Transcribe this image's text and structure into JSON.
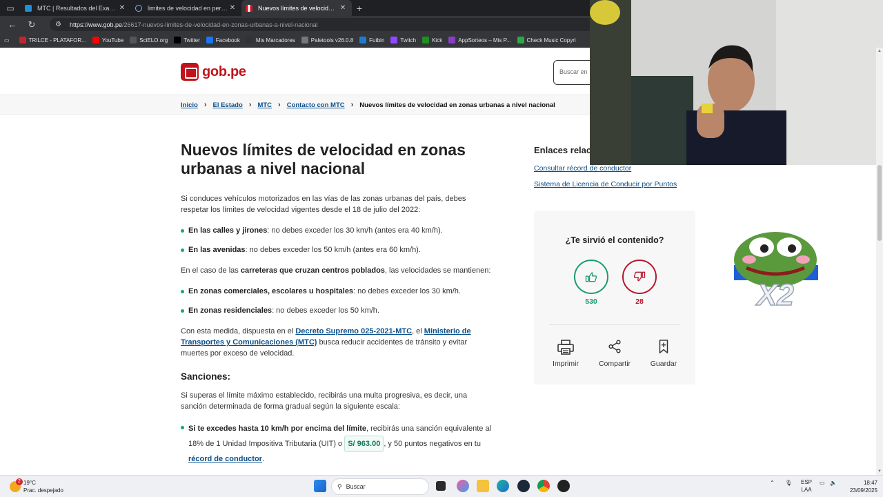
{
  "browser": {
    "tabs": [
      {
        "title": "MTC | Resultados del Examen de",
        "active": false
      },
      {
        "title": "limites de velocidad en peru - Bú",
        "active": false
      },
      {
        "title": "Nuevos límites de velocidad en zo",
        "active": true
      }
    ],
    "url_host": "https://www.gob.pe",
    "url_path": "/26617-nuevos-limites-de-velocidad-en-zonas-urbanas-a-nivel-nacional",
    "bookmarks": [
      {
        "label": "TRILCE - PLATAFOR...",
        "icon": "trilce-icon",
        "color": "#c0262d"
      },
      {
        "label": "YouTube",
        "icon": "youtube-icon",
        "color": "#ff0000"
      },
      {
        "label": "SciELO.org",
        "icon": "scielo-icon",
        "color": "#555555"
      },
      {
        "label": "Twitter",
        "icon": "x-icon",
        "color": "#000000"
      },
      {
        "label": "Facebook",
        "icon": "facebook-icon",
        "color": "#1877f2"
      },
      {
        "label": "Mis Marcadores",
        "icon": "bookmark-c-icon",
        "color": "#333333"
      },
      {
        "label": "Paletools v26.0.8",
        "icon": "globe-icon",
        "color": "#777777"
      },
      {
        "label": "Futbin",
        "icon": "futbin-icon",
        "color": "#1d7bd0"
      },
      {
        "label": "Twitch",
        "icon": "twitch-icon",
        "color": "#9146ff"
      },
      {
        "label": "Kick",
        "icon": "kick-icon",
        "color": "#1f8f1f"
      },
      {
        "label": "AppSorteos – Mis P...",
        "icon": "appsorteos-icon",
        "color": "#8a3cc9"
      },
      {
        "label": "Check Music Copyri",
        "icon": "check-icon",
        "color": "#2aa84a"
      }
    ]
  },
  "site": {
    "logo_text": "gob.pe",
    "search_placeholder": "Buscar en",
    "breadcrumbs": [
      "Inicio",
      "El Estado",
      "MTC",
      "Contacto con MTC"
    ],
    "breadcrumb_current": "Nuevos límites de velocidad en zonas urbanas a nivel nacional"
  },
  "article": {
    "title": "Nuevos límites de velocidad en zonas urbanas a nivel nacional",
    "intro": "Si conduces vehículos motorizados en las vías de las zonas urbanas del país, debes respetar los límites de velocidad vigentes desde el 18 de julio del 2022:",
    "urban_limits": [
      {
        "bold": "En las calles y jirones",
        "rest": ": no debes exceder los 30 km/h (antes era 40 km/h)."
      },
      {
        "bold": "En las avenidas",
        "rest": ": no debes exceder los 50 km/h (antes era 60 km/h)."
      }
    ],
    "roads_pre": "En el caso de las ",
    "roads_bold": "carreteras que cruzan centros poblados",
    "roads_post": ", las velocidades se mantienen:",
    "road_limits": [
      {
        "bold": "En zonas comerciales, escolares u hospitales",
        "rest": ": no debes exceder los 30 km/h."
      },
      {
        "bold": "En zonas residenciales",
        "rest": ": no debes exceder los 50 km/h."
      }
    ],
    "measure_pre": "Con esta medida, dispuesta en el ",
    "measure_link1": "Decreto Supremo 025-2021-MTC",
    "measure_mid": ", el ",
    "measure_link2": "Ministerio de Transportes y Comunicaciones (MTC)",
    "measure_post": " busca reducir accidentes de tránsito y evitar muertes por exceso de velocidad.",
    "sanctions_title": "Sanciones:",
    "sanctions_intro": "Si superas el límite máximo establecido, recibirás una multa progresiva, es decir, una sanción determinada de forma gradual según la siguiente escala:",
    "sanction1_bold": "Si te excedes hasta 10 km/h por encima del límite",
    "sanction1_mid": ", recibirás una sanción equivalente al 18% de 1 Unidad Impositiva Tributaria (UIT) o ",
    "sanction1_price": "S/ 963.00",
    "sanction1_post": ", y 50 puntos negativos en tu ",
    "sanction1_link": "récord de conductor",
    "sanction1_end": "."
  },
  "sidebar": {
    "related_title": "Enlaces relacionados",
    "related_links": [
      "Consultar récord de conductor",
      "Sistema de Licencia de Conducir por Puntos"
    ],
    "feedback_question": "¿Te sirvió el contenido?",
    "likes": "530",
    "dislikes": "28",
    "actions": [
      "Imprimir",
      "Compartir",
      "Guardar"
    ]
  },
  "emote": {
    "text": "X2"
  },
  "taskbar": {
    "temperature": "19°C",
    "weather_desc": "Prac. despejado",
    "weather_badge": "2",
    "search_label": "Buscar",
    "lang_top": "ESP",
    "lang_bottom": "LAA",
    "time": "18:47",
    "date": "23/09/2025"
  },
  "colors": {
    "gob_red": "#c2131a",
    "link_blue": "#0b4f8a",
    "like_green": "#1a9b72",
    "dislike_red": "#b3162a",
    "bullet_green": "#1aa37a"
  }
}
